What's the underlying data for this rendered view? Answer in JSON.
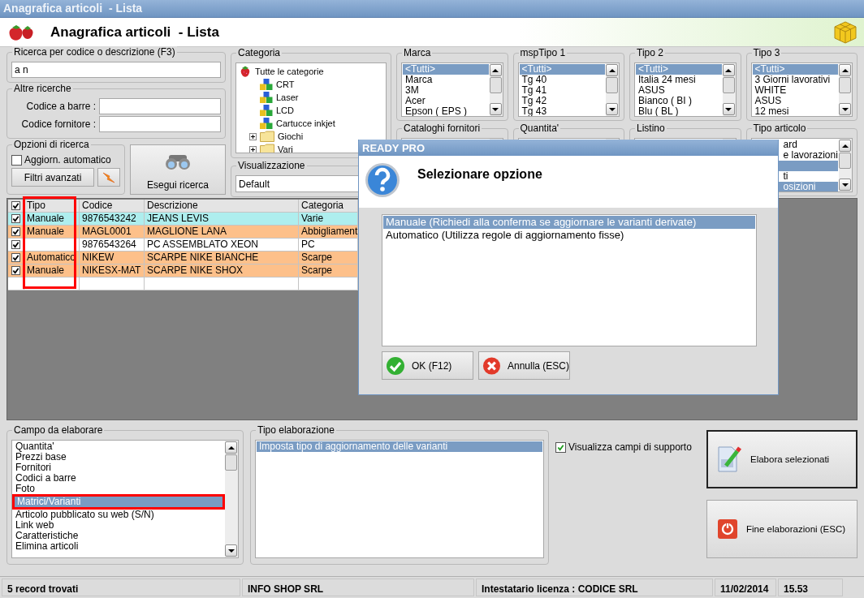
{
  "window": {
    "title": "Anagrafica articoli  - Lista"
  },
  "header": {
    "title": "Anagrafica articoli  - Lista"
  },
  "search": {
    "label": "Ricerca per codice o descrizione (F3)",
    "value": "a n"
  },
  "other_searches": {
    "label": "Altre ricerche",
    "fields": [
      {
        "label": "Codice a barre :"
      },
      {
        "label": "Codice fornitore :"
      }
    ]
  },
  "search_options": {
    "label": "Opzioni di ricerca",
    "auto_update": {
      "label": "Aggiorn. automatico",
      "checked": false
    },
    "advanced_button": "Filtri avanzati"
  },
  "run_search_button": "Esegui ricerca",
  "category": {
    "label": "Categoria",
    "tree": [
      {
        "label": "Tutte le categorie",
        "kind": "root",
        "children": [
          {
            "label": "CRT",
            "kind": "leaf"
          },
          {
            "label": "Laser",
            "kind": "leaf"
          },
          {
            "label": "LCD",
            "kind": "leaf"
          },
          {
            "label": "Cartucce inkjet",
            "kind": "leaf"
          },
          {
            "label": "Giochi",
            "kind": "folder",
            "expanded": false
          },
          {
            "label": "Vari",
            "kind": "folder",
            "expanded": false
          }
        ]
      }
    ]
  },
  "view": {
    "label": "Visualizzazione",
    "value": "Default"
  },
  "filters": [
    {
      "label": "Marca",
      "items": [
        {
          "text": "<Tutti>",
          "selected": true
        },
        {
          "text": "Marca",
          "selected": false
        },
        {
          "text": "3M",
          "selected": false
        },
        {
          "text": "Acer",
          "selected": false
        },
        {
          "text": "Epson ( EPS )",
          "selected": false
        }
      ]
    },
    {
      "label": "mspTipo 1",
      "items": [
        {
          "text": "<Tutti>",
          "selected": true
        },
        {
          "text": "Tg 40",
          "selected": false
        },
        {
          "text": "Tg 41",
          "selected": false
        },
        {
          "text": "Tg 42",
          "selected": false
        },
        {
          "text": "Tg 43",
          "selected": false
        }
      ]
    },
    {
      "label": "Tipo 2",
      "items": [
        {
          "text": "<Tutti>",
          "selected": true
        },
        {
          "text": "Italia 24 mesi",
          "selected": false
        },
        {
          "text": "ASUS",
          "selected": false
        },
        {
          "text": "Bianco ( BI )",
          "selected": false
        },
        {
          "text": "Blu ( BL )",
          "selected": false
        }
      ]
    },
    {
      "label": "Tipo 3",
      "items": [
        {
          "text": "<Tutti>",
          "selected": true
        },
        {
          "text": "3 Giorni lavorativi",
          "selected": false
        },
        {
          "text": "WHITE",
          "selected": false
        },
        {
          "text": "ASUS",
          "selected": false
        },
        {
          "text": "12 mesi",
          "selected": false
        }
      ]
    },
    {
      "label": "Cataloghi fornitori"
    },
    {
      "label": "Quantita'"
    },
    {
      "label": "Listino"
    },
    {
      "label": "Tipo articolo",
      "items": [
        {
          "text": "ard",
          "selected": false
        },
        {
          "text": "e lavorazioni",
          "selected": false
        },
        {
          "selected": true
        },
        {
          "text": "ti",
          "selected": false
        },
        {
          "text": "osizioni",
          "selected": true
        }
      ]
    }
  ],
  "grid": {
    "header_checked": true,
    "columns": [
      {
        "label": "Tipo",
        "highlighted": true
      },
      {
        "label": "Codice",
        "highlighted": false
      },
      {
        "label": "Descrizione",
        "highlighted": false
      },
      {
        "label": "Categoria",
        "highlighted": false
      }
    ],
    "rows": [
      {
        "checked": true,
        "color": "#aeeeee",
        "cells": [
          "Manuale",
          "9876543242",
          "JEANS LEVIS",
          "Varie"
        ]
      },
      {
        "checked": true,
        "color": "#fdc08a",
        "cells": [
          "Manuale",
          "MAGL0001",
          "MAGLIONE LANA",
          "Abbigliament"
        ]
      },
      {
        "checked": true,
        "color": "#ffffff",
        "cells": [
          null,
          "9876543264",
          "PC ASSEMBLATO XEON",
          "PC"
        ]
      },
      {
        "checked": true,
        "color": "#fdc08a",
        "cells": [
          "Automatico",
          "NIKEW",
          "SCARPE NIKE BIANCHE",
          "Scarpe"
        ]
      },
      {
        "checked": true,
        "color": "#fdc08a",
        "cells": [
          "Manuale",
          "NIKESX-MAT",
          "SCARPE NIKE SHOX",
          "Scarpe"
        ]
      }
    ]
  },
  "process_field": {
    "label": "Campo da elaborare",
    "items": [
      {
        "text": "Quantita'",
        "selected": false
      },
      {
        "text": "Prezzi base",
        "selected": false
      },
      {
        "text": "Fornitori",
        "selected": false
      },
      {
        "text": "Codici a barre",
        "selected": false
      },
      {
        "text": "Foto",
        "selected": false
      },
      {
        "text": "Matrici/Varianti",
        "selected": true,
        "highlighted": true
      },
      {
        "text": "Articolo pubblicato su web (S/N)",
        "selected": false
      },
      {
        "text": "Link web",
        "selected": false
      },
      {
        "text": "Caratteristiche",
        "selected": false
      },
      {
        "text": "Elimina articoli",
        "selected": false
      }
    ]
  },
  "process_type": {
    "label": "Tipo elaborazione",
    "items": [
      {
        "text": "Imposta tipo di aggiornamento delle varianti",
        "selected": true
      }
    ]
  },
  "support_fields": {
    "label": "Visualizza campi di supporto",
    "checked": true
  },
  "actions": [
    {
      "label": "Elabora selezionati",
      "kind": "edit",
      "focused": true
    },
    {
      "label": "Fine elaborazioni (ESC)",
      "kind": "power",
      "focused": false
    }
  ],
  "status_bar": [
    "5 record trovati",
    "INFO SHOP SRL",
    "Intestatario licenza : CODICE SRL",
    "11/02/2014",
    "15.53"
  ],
  "dialog": {
    "title": "READY PRO",
    "heading": "Selezionare opzione",
    "options": [
      {
        "text": "Manuale (Richiedi alla conferma se aggiornare le varianti derivate)",
        "selected": true
      },
      {
        "text": "Automatico (Utilizza regole di aggiornamento fisse)",
        "selected": false
      }
    ],
    "buttons": [
      {
        "label": "OK (F12)",
        "kind": "ok"
      },
      {
        "label": "Annulla (ESC)",
        "kind": "cancel"
      }
    ]
  }
}
